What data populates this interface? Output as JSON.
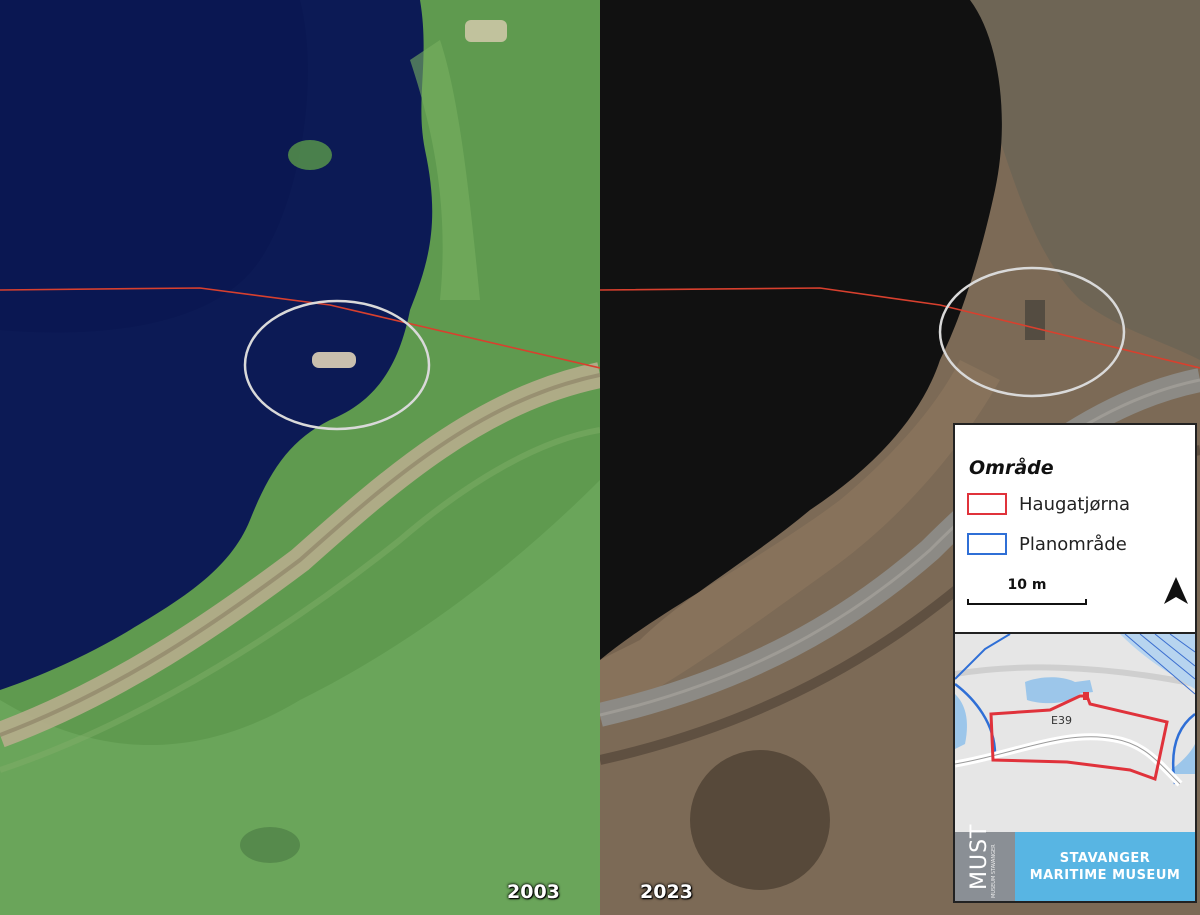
{
  "panels": {
    "left": {
      "year": "2003"
    },
    "right": {
      "year": "2023"
    }
  },
  "legend": {
    "title": "Område",
    "items": [
      {
        "label": "Haugatjørna",
        "color": "#e0323b"
      },
      {
        "label": "Planområde",
        "color": "#2f6fd6"
      }
    ],
    "scale_label": "10 m",
    "north_arrow_icon": "north-arrow-icon"
  },
  "overview_map": {
    "road_label": "E39"
  },
  "logo": {
    "short_name": "MUST",
    "sub_name": "MUSEUM STAVANGER",
    "line1": "STAVANGER",
    "line2": "MARITIME MUSEUM",
    "band_color": "#58b5e3"
  },
  "colors": {
    "boundary_red": "#d8402e",
    "highlight_circle": "#d9d9d9",
    "water_2003": "#0c1a55",
    "water_2023": "#101010"
  }
}
